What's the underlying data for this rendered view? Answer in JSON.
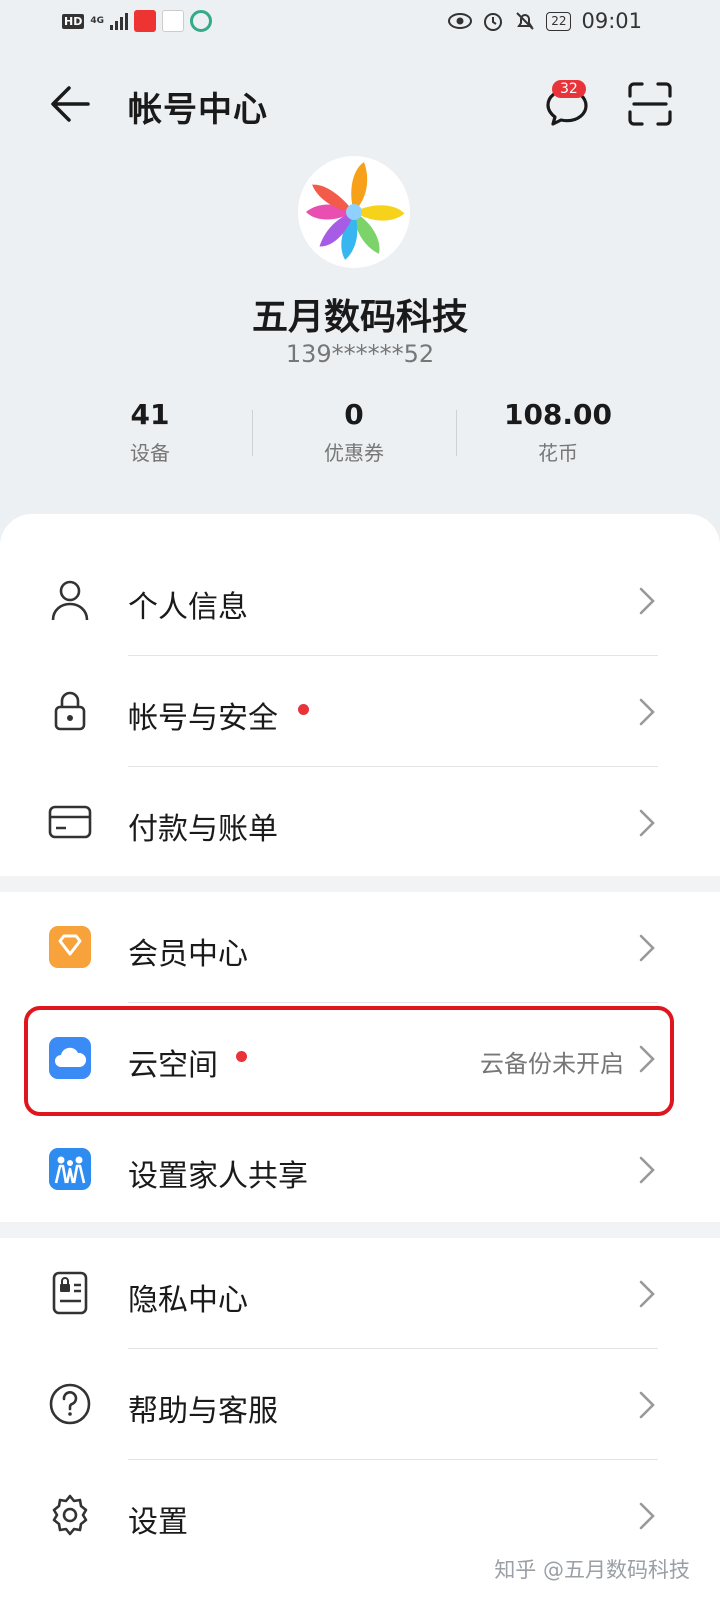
{
  "status_bar": {
    "left": {
      "hd": "HD",
      "network": "4G"
    },
    "battery": "22",
    "time": "09:01"
  },
  "header": {
    "title": "帐号中心",
    "message_badge": "32"
  },
  "profile": {
    "name": "五月数码科技",
    "phone": "139******52"
  },
  "stats": [
    {
      "value": "41",
      "label": "设备"
    },
    {
      "value": "0",
      "label": "优惠券"
    },
    {
      "value": "108.00",
      "label": "花币"
    }
  ],
  "menu": {
    "group1": [
      {
        "label": "个人信息",
        "icon": "person-icon"
      },
      {
        "label": "帐号与安全",
        "icon": "lock-icon",
        "dot": true
      },
      {
        "label": "付款与账单",
        "icon": "card-icon"
      }
    ],
    "group2": [
      {
        "label": "会员中心",
        "icon": "diamond-icon"
      },
      {
        "label": "云空间",
        "icon": "cloud-icon",
        "dot": true,
        "value": "云备份未开启"
      },
      {
        "label": "设置家人共享",
        "icon": "family-icon"
      }
    ],
    "group3": [
      {
        "label": "隐私中心",
        "icon": "privacy-icon"
      },
      {
        "label": "帮助与客服",
        "icon": "help-icon"
      },
      {
        "label": "设置",
        "icon": "gear-icon"
      }
    ]
  },
  "watermark": "知乎 @五月数码科技",
  "colors": {
    "accent_red": "#e8333a",
    "highlight_border": "#e0161e",
    "background": "#edf0f3"
  }
}
